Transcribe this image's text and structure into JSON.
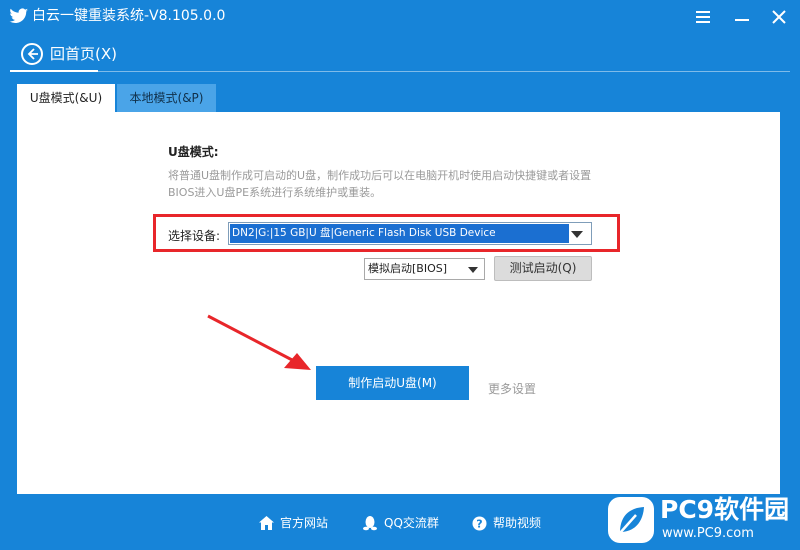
{
  "window": {
    "title": "白云一键重装系统-V8.105.0.0"
  },
  "nav": {
    "back_label": "回首页(X)"
  },
  "tabs": [
    {
      "label": "U盘模式(&U)",
      "active": true
    },
    {
      "label": "本地模式(&P)",
      "active": false
    }
  ],
  "usb_mode": {
    "title": "U盘模式:",
    "description": "将普通U盘制作成可启动的U盘，制作成功后可以在电脑开机时使用启动快捷键或者设置BIOS进入U盘PE系统进行系统维护或重装。",
    "device_label": "选择设备:",
    "device_value": "DN2|G:|15 GB|U 盘|Generic Flash Disk USB Device",
    "boot_mode_value": "模拟启动[BIOS]",
    "test_button": "测试启动(Q)",
    "make_button": "制作启动U盘(M)",
    "more_settings": "更多设置"
  },
  "footer": {
    "site": "官方网站",
    "qq": "QQ交流群",
    "help": "帮助视频"
  },
  "watermark": {
    "title": "PC9软件园",
    "url": "www.PC9.com"
  },
  "colors": {
    "brand_blue": "#1784d8",
    "highlight_red": "#e8262a",
    "selection_blue": "#1b6fd1"
  },
  "icons": {
    "app_logo": "bird-icon",
    "menu": "menu-icon",
    "minimize": "minimize-icon",
    "close": "close-icon",
    "back": "arrow-left-icon",
    "site": "home-icon",
    "qq": "qq-penguin-icon",
    "help": "help-icon"
  }
}
